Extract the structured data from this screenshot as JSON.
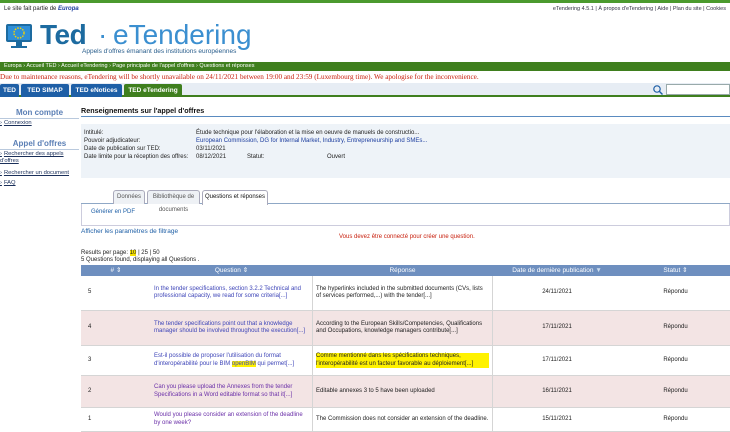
{
  "topbar": {
    "eu_notice": "Le site fait partie de",
    "eu_brand": "Europa",
    "links": "eTendering 4.5.1 | À propos d'eTendering | Aide | Plan du site | Cookies"
  },
  "header": {
    "logo_ted": "Ted",
    "logo_sep": "·",
    "logo_etendering": "eTendering",
    "tagline": "Appels d'offres émanant des institutions européennes"
  },
  "breadcrumb": "Europa › Accueil TED › Accueil eTendering › Page principale de l'appel d'offres › Questions et réponses",
  "notice": "Due to maintenance reasons, eTendering will be shortly unavailable on 24/11/2021 between 19:00 and 23:59 (Luxembourg time). We apologise for the inconvenience.",
  "tabs": [
    {
      "label": "TED"
    },
    {
      "label": "TED SIMAP"
    },
    {
      "label": "TED eNotices"
    },
    {
      "label": "TED eTendering"
    }
  ],
  "sidebar": {
    "account_title": "Mon compte",
    "login": "Connexion",
    "tenders_title": "Appel d'offres",
    "links": [
      {
        "label": "Rechercher des appels d'offres"
      },
      {
        "label": "Rechercher un document"
      },
      {
        "label": "FAQ"
      }
    ]
  },
  "main": {
    "section_title": "Renseignements sur l'appel d'offres",
    "info": {
      "intitule_label": "Intitulé:",
      "intitule_value": "Étude technique pour l'élaboration et la mise en oeuvre de manuels de constructio...",
      "pouvoir_label": "Pouvoir adjudicateur:",
      "pouvoir_value": "European Commission, DG for Internal Market, Industry, Entrepreneurship and SMEs...",
      "date_pub_label": "Date de publication sur TED:",
      "date_pub_value": "03/11/2021",
      "date_limit_label": "Date limite pour la réception des offres:",
      "date_limit_value": "08/12/2021",
      "statut_label": "Statut:",
      "statut_value": "Ouvert"
    },
    "subtabs": [
      {
        "label": "Données"
      },
      {
        "label": "Bibliothèque de documents"
      },
      {
        "label": "Questions et réponses"
      }
    ],
    "generate_pdf": "Générer en PDF",
    "filters": "Afficher les paramètres de filtrage",
    "connect_msg": "Vous devez être connecté pour créer une question.",
    "results_per_page_prefix": "Results per page:",
    "per_page_selected": "10",
    "per_page_rest": "| 25 | 50",
    "found": "5 Questions found, displaying all Questions .",
    "columns": {
      "num": "#",
      "question": "Question",
      "reponse": "Réponse",
      "date": "Date de dernière publication",
      "statut": "Statut"
    },
    "rows": [
      {
        "num": "5",
        "question": "In the tender specifications, section 3.2.2 Technical and professional capacity, we read for some criteria[...]",
        "reponse": "The hyperlinks included in the submitted documents (CVs, lists of services performed,...) with the tender[...]",
        "date": "24/11/2021",
        "statut": "Répondu"
      },
      {
        "num": "4",
        "question": "The tender specifications point out that a knowledge manager should be involved throughout the execution[...]",
        "reponse": "According to the European Skills/Competencies, Qualifications and Occupations, knowledge managers contribute[...]",
        "date": "17/11/2021",
        "statut": "Répondu"
      },
      {
        "num": "3",
        "question_pre": "Est-il possible de proposer l'utilisation du format d'interopérabilité pour le BIM ",
        "question_hl": "openBIM",
        "question_post": " qui permet[...]",
        "reponse": "Comme mentionné dans les spécifications techniques, l'interopérabilité est un facteur favorable au déploiement[...]",
        "date": "17/11/2021",
        "statut": "Répondu"
      },
      {
        "num": "2",
        "question": "Can you please upload the Annexes from the tender Specifications in a Word editable format so that it[...]",
        "reponse": "Editable annexes 3 to 5 have been uploaded",
        "date": "16/11/2021",
        "statut": "Répondu"
      },
      {
        "num": "1",
        "question": "Would you please consider an extension of the deadline by one week?",
        "reponse": "The Commission does not consider an extension of the deadline.",
        "date": "15/11/2021",
        "statut": "Répondu"
      }
    ]
  }
}
